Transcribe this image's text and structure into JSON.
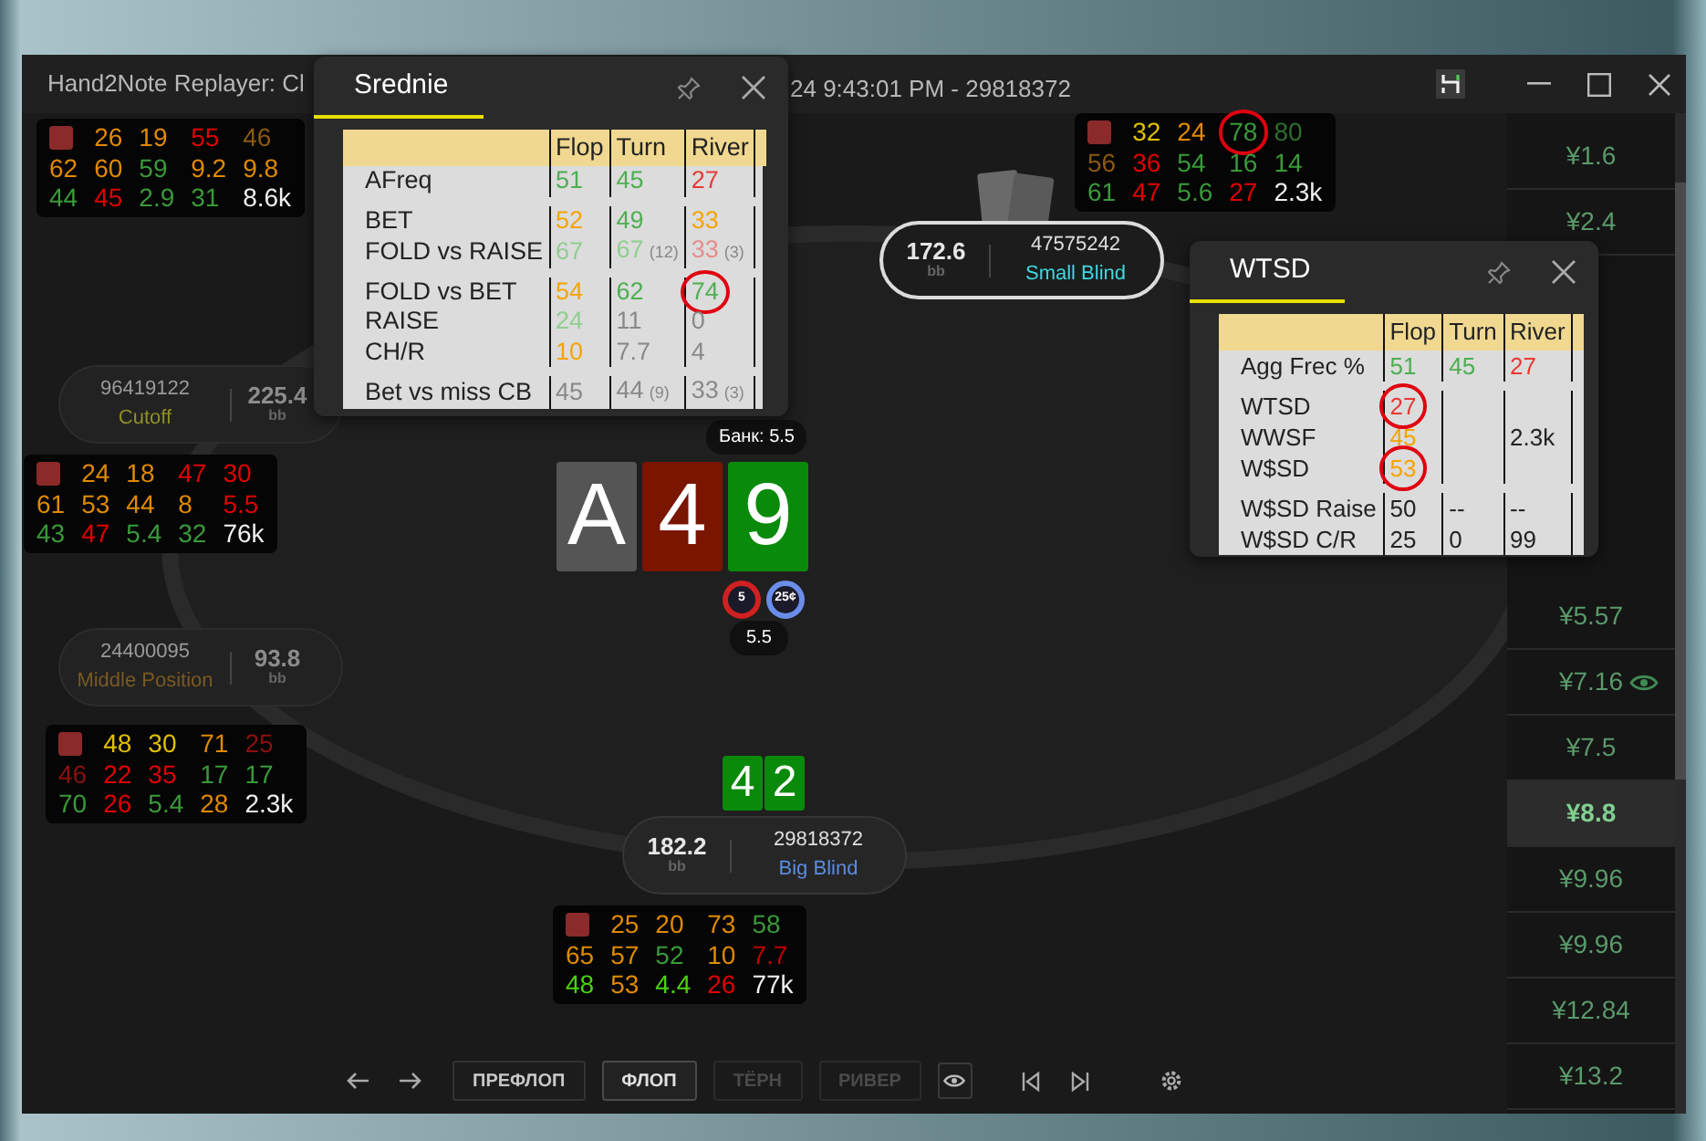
{
  "window": {
    "title_start": "Hand2Note Replayer: Cl",
    "title_end": "24 9:43:01 PM - 29818372"
  },
  "huds": [
    {
      "rows": [
        [
          {
            "kind": "marker",
            "color": "#8b2a2a"
          },
          {
            "kind": "stat",
            "text": "26",
            "color": "#e08a00"
          },
          {
            "kind": "stat",
            "text": "19",
            "color": "#e08a00"
          },
          {
            "kind": "stat",
            "text": "55",
            "color": "#e00000"
          },
          {
            "kind": "stat",
            "text": "46",
            "color": "#8a5a10"
          }
        ],
        [
          {
            "kind": "stat",
            "text": "62",
            "color": "#e08a00"
          },
          {
            "kind": "stat",
            "text": "60",
            "color": "#e08a00"
          },
          {
            "kind": "stat",
            "text": "59",
            "color": "#3a9a3a"
          },
          {
            "kind": "stat",
            "text": "9.2",
            "color": "#e08a00"
          },
          {
            "kind": "stat",
            "text": "9.8",
            "color": "#e08a00"
          }
        ],
        [
          {
            "kind": "stat",
            "text": "44",
            "color": "#3a9a3a"
          },
          {
            "kind": "stat",
            "text": "45",
            "color": "#e00000"
          },
          {
            "kind": "stat",
            "text": "2.9",
            "color": "#3a9a3a"
          },
          {
            "kind": "stat",
            "text": "31",
            "color": "#3a9a3a"
          },
          {
            "kind": "stat",
            "text": "8.6k",
            "color": "#f0f0f0"
          }
        ]
      ]
    },
    {
      "rows": [
        [
          {
            "kind": "marker",
            "color": "#8b2a2a"
          },
          {
            "kind": "stat",
            "text": "32",
            "color": "#e0c000"
          },
          {
            "kind": "stat",
            "text": "24",
            "color": "#e08a00"
          },
          {
            "kind": "stat",
            "text": "78",
            "color": "#3a9a3a",
            "circled": true
          },
          {
            "kind": "stat",
            "text": "80",
            "color": "#2e6e2e"
          }
        ],
        [
          {
            "kind": "stat",
            "text": "56",
            "color": "#8a5a10"
          },
          {
            "kind": "stat",
            "text": "36",
            "color": "#e00000"
          },
          {
            "kind": "stat",
            "text": "54",
            "color": "#3a9a3a"
          },
          {
            "kind": "stat",
            "text": "16",
            "color": "#3a9a3a"
          },
          {
            "kind": "stat",
            "text": "14",
            "color": "#3a9a3a"
          }
        ],
        [
          {
            "kind": "stat",
            "text": "61",
            "color": "#3a9a3a"
          },
          {
            "kind": "stat",
            "text": "47",
            "color": "#e00000"
          },
          {
            "kind": "stat",
            "text": "5.6",
            "color": "#3a9a3a"
          },
          {
            "kind": "stat",
            "text": "27",
            "color": "#e00000"
          },
          {
            "kind": "stat",
            "text": "2.3k",
            "color": "#f0f0f0"
          }
        ]
      ]
    },
    {
      "rows": [
        [
          {
            "kind": "marker",
            "color": "#8b2a2a"
          },
          {
            "kind": "stat",
            "text": "24",
            "color": "#e08a00"
          },
          {
            "kind": "stat",
            "text": "18",
            "color": "#e08a00"
          },
          {
            "kind": "stat",
            "text": "47",
            "color": "#e00000"
          },
          {
            "kind": "stat",
            "text": "30",
            "color": "#e00000"
          }
        ],
        [
          {
            "kind": "stat",
            "text": "61",
            "color": "#e08a00"
          },
          {
            "kind": "stat",
            "text": "53",
            "color": "#e08a00"
          },
          {
            "kind": "stat",
            "text": "44",
            "color": "#e08a00"
          },
          {
            "kind": "stat",
            "text": "8",
            "color": "#e08a00"
          },
          {
            "kind": "stat",
            "text": "5.5",
            "color": "#e00000"
          }
        ],
        [
          {
            "kind": "stat",
            "text": "43",
            "color": "#3a9a3a"
          },
          {
            "kind": "stat",
            "text": "47",
            "color": "#e00000"
          },
          {
            "kind": "stat",
            "text": "5.4",
            "color": "#3a9a3a"
          },
          {
            "kind": "stat",
            "text": "32",
            "color": "#3a9a3a"
          },
          {
            "kind": "stat",
            "text": "76k",
            "color": "#f0f0f0"
          }
        ]
      ]
    },
    {
      "rows": [
        [
          {
            "kind": "marker",
            "color": "#8b2a2a"
          },
          {
            "kind": "stat",
            "text": "48",
            "color": "#e0c000"
          },
          {
            "kind": "stat",
            "text": "30",
            "color": "#e0c000"
          },
          {
            "kind": "stat",
            "text": "71",
            "color": "#e08a00"
          },
          {
            "kind": "stat",
            "text": "25",
            "color": "#8b1010"
          }
        ],
        [
          {
            "kind": "stat",
            "text": "46",
            "color": "#8b1010"
          },
          {
            "kind": "stat",
            "text": "22",
            "color": "#e00000"
          },
          {
            "kind": "stat",
            "text": "35",
            "color": "#e00000"
          },
          {
            "kind": "stat",
            "text": "17",
            "color": "#3a9a3a"
          },
          {
            "kind": "stat",
            "text": "17",
            "color": "#3a9a3a"
          }
        ],
        [
          {
            "kind": "stat",
            "text": "70",
            "color": "#3a9a3a"
          },
          {
            "kind": "stat",
            "text": "26",
            "color": "#e00000"
          },
          {
            "kind": "stat",
            "text": "5.4",
            "color": "#3a9a3a"
          },
          {
            "kind": "stat",
            "text": "28",
            "color": "#e08a00"
          },
          {
            "kind": "stat",
            "text": "2.3k",
            "color": "#f0f0f0"
          }
        ]
      ]
    },
    {
      "rows": [
        [
          {
            "kind": "marker",
            "color": "#8b2a2a"
          },
          {
            "kind": "stat",
            "text": "25",
            "color": "#e08a00"
          },
          {
            "kind": "stat",
            "text": "20",
            "color": "#e08a00"
          },
          {
            "kind": "stat",
            "text": "73",
            "color": "#e08a00"
          },
          {
            "kind": "stat",
            "text": "58",
            "color": "#3a9a3a"
          }
        ],
        [
          {
            "kind": "stat",
            "text": "65",
            "color": "#e08a00"
          },
          {
            "kind": "stat",
            "text": "57",
            "color": "#e08a00"
          },
          {
            "kind": "stat",
            "text": "52",
            "color": "#3a9a3a"
          },
          {
            "kind": "stat",
            "text": "10",
            "color": "#e08a00"
          },
          {
            "kind": "stat",
            "text": "7.7",
            "color": "#c00000"
          }
        ],
        [
          {
            "kind": "stat",
            "text": "48",
            "color": "#4cd010"
          },
          {
            "kind": "stat",
            "text": "53",
            "color": "#e08a00"
          },
          {
            "kind": "stat",
            "text": "4.4",
            "color": "#4cd010"
          },
          {
            "kind": "stat",
            "text": "26",
            "color": "#e00000"
          },
          {
            "kind": "stat",
            "text": "77k",
            "color": "#f0f0f0"
          }
        ]
      ]
    }
  ],
  "seats": [
    {
      "stack": "172.6",
      "unit": "bb",
      "player": "47575242",
      "position": "Small Blind",
      "color": "#3fd8e0",
      "active": true,
      "folded": false,
      "card_backs": true
    },
    {
      "stack": "225.4",
      "unit": "bb",
      "player": "96419122",
      "position": "Cutoff",
      "color": "#8f8f2a",
      "active": false,
      "folded": true,
      "card_backs": false
    },
    {
      "stack": "93.8",
      "unit": "bb",
      "player": "24400095",
      "position": "Middle Position",
      "color": "#7a5a22",
      "active": false,
      "folded": true,
      "card_backs": false
    },
    {
      "stack": "182.2",
      "unit": "bb",
      "player": "29818372",
      "position": "Big Blind",
      "color": "#5a8de0",
      "active": false,
      "folded": false,
      "card_backs": false,
      "hole_cards": [
        {
          "rank": "4",
          "color": "#0a8a0a"
        },
        {
          "rank": "2",
          "color": "#0a8a0a"
        }
      ]
    }
  ],
  "pot": "Банк: 5.5",
  "board": [
    {
      "rank": "A",
      "color": "#555555"
    },
    {
      "rank": "4",
      "color": "#7a1500"
    },
    {
      "rank": "9",
      "color": "#0a8a0a"
    }
  ],
  "chips": [
    {
      "label": "5",
      "color": "#d02020"
    },
    {
      "label": "25¢",
      "color": "#6a8ee8"
    }
  ],
  "bet": "5.5",
  "streets": [
    {
      "label": "ПРЕФЛОП",
      "selected": false,
      "disabled": false
    },
    {
      "label": "ФЛОП",
      "selected": true,
      "disabled": false
    },
    {
      "label": "ТЁРН",
      "selected": false,
      "disabled": true
    },
    {
      "label": "РИВЕР",
      "selected": false,
      "disabled": true
    }
  ],
  "popups": [
    {
      "title": "Srednie",
      "columns": [
        "Flop",
        "Turn",
        "River"
      ],
      "groups": [
        [
          {
            "label": "AFreq",
            "cells": [
              {
                "text": "51",
                "color": "#4caf50"
              },
              {
                "text": "45",
                "color": "#4caf50"
              },
              {
                "text": "27",
                "color": "#e53935"
              }
            ]
          }
        ],
        [
          {
            "label": "BET",
            "cells": [
              {
                "text": "52",
                "color": "#f5a300"
              },
              {
                "text": "49",
                "color": "#4caf50"
              },
              {
                "text": "33",
                "color": "#f5a300"
              }
            ]
          },
          {
            "label": "FOLD vs RAISE",
            "cells": [
              {
                "text": "67",
                "color": "#8fce8f"
              },
              {
                "text": "67",
                "color": "#8fce8f",
                "sample": "(12)"
              },
              {
                "text": "33",
                "color": "#e88a8a",
                "sample": "(3)"
              }
            ]
          }
        ],
        [
          {
            "label": "FOLD vs BET",
            "cells": [
              {
                "text": "54",
                "color": "#f5a300"
              },
              {
                "text": "62",
                "color": "#4caf50"
              },
              {
                "text": "74",
                "color": "#4caf50",
                "circled": true
              }
            ]
          },
          {
            "label": "RAISE",
            "cells": [
              {
                "text": "24",
                "color": "#8fce8f"
              },
              {
                "text": "11",
                "color": "#888888"
              },
              {
                "text": "0",
                "color": "#888888"
              }
            ]
          },
          {
            "label": "CH/R",
            "cells": [
              {
                "text": "10",
                "color": "#f5a300"
              },
              {
                "text": "7.7",
                "color": "#888888"
              },
              {
                "text": "4",
                "color": "#888888"
              }
            ]
          }
        ],
        [
          {
            "label": "Bet vs miss CB",
            "cells": [
              {
                "text": "45",
                "color": "#888888"
              },
              {
                "text": "44",
                "color": "#888888",
                "sample": "(9)"
              },
              {
                "text": "33",
                "color": "#888888",
                "sample": "(3)"
              }
            ]
          }
        ]
      ]
    },
    {
      "title": "WTSD",
      "columns": [
        "Flop",
        "Turn",
        "River"
      ],
      "groups": [
        [
          {
            "label": "Agg Frec %",
            "cells": [
              {
                "text": "51",
                "color": "#4caf50"
              },
              {
                "text": "45",
                "color": "#4caf50"
              },
              {
                "text": "27",
                "color": "#e53935"
              }
            ]
          }
        ],
        [
          {
            "label": "WTSD",
            "cells": [
              {
                "text": "27",
                "color": "#e53935",
                "circled": true
              },
              null,
              null
            ]
          },
          {
            "label": "WWSF",
            "cells": [
              {
                "text": "45",
                "color": "#f5a300"
              },
              null,
              {
                "text": "2.3k",
                "color": "#222222"
              }
            ]
          },
          {
            "label": "W$SD",
            "cells": [
              {
                "text": "53",
                "color": "#f5a300",
                "circled": true
              },
              null,
              null
            ]
          }
        ],
        [
          {
            "label": "W$SD Raise",
            "cells": [
              {
                "text": "50",
                "color": "#222222"
              },
              {
                "text": "--",
                "color": "#222222"
              },
              {
                "text": "--",
                "color": "#222222"
              }
            ]
          },
          {
            "label": "W$SD C/R",
            "cells": [
              {
                "text": "25",
                "color": "#222222"
              },
              {
                "text": "0",
                "color": "#222222"
              },
              {
                "text": "99",
                "color": "#222222"
              }
            ]
          }
        ]
      ]
    }
  ],
  "hands": {
    "top": [
      {
        "amount": "¥1.6",
        "selected": false,
        "watched": false
      },
      {
        "amount": "¥2.4",
        "selected": false,
        "watched": false
      }
    ],
    "bottom": [
      {
        "amount": "¥5.57",
        "selected": false,
        "watched": false
      },
      {
        "amount": "¥7.16",
        "selected": false,
        "watched": true
      },
      {
        "amount": "¥7.5",
        "selected": false,
        "watched": false
      },
      {
        "amount": "¥8.8",
        "selected": true,
        "watched": false
      },
      {
        "amount": "¥9.96",
        "selected": false,
        "watched": false
      },
      {
        "amount": "¥9.96",
        "selected": false,
        "watched": false
      },
      {
        "amount": "¥12.84",
        "selected": false,
        "watched": false
      },
      {
        "amount": "¥13.2",
        "selected": false,
        "watched": false
      }
    ]
  }
}
